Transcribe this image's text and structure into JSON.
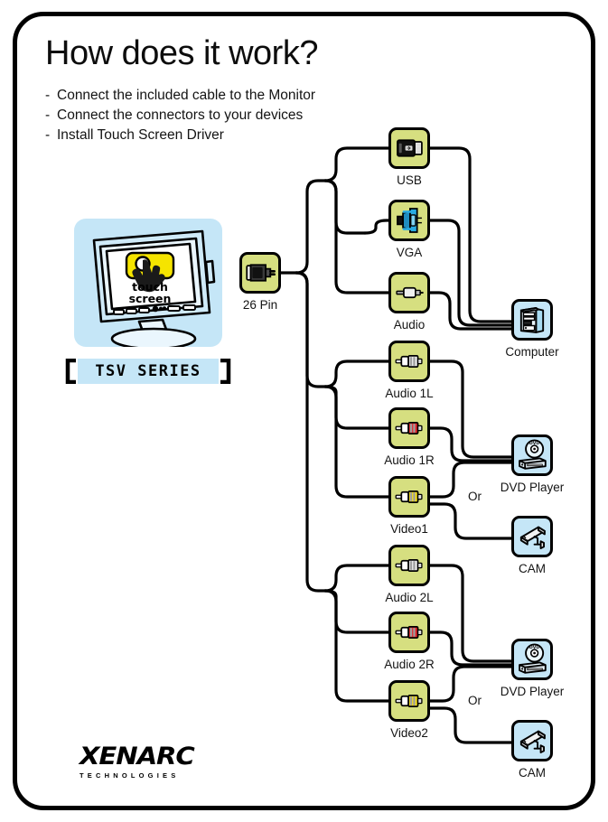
{
  "header": {
    "title": "How does it work?",
    "dash": "-",
    "steps": [
      "Connect the included cable to the Monitor",
      "Connect the connectors to your devices",
      "Install Touch Screen Driver"
    ]
  },
  "monitor": {
    "screen_line1": "touch",
    "screen_line2": "screen",
    "series_label": "TSV  SERIES",
    "bracket_left": "[",
    "bracket_right": "]"
  },
  "source": {
    "label": "26 Pin",
    "icon": "dsub-26pin-connector-icon"
  },
  "connectors": [
    {
      "id": "usb",
      "label": "USB",
      "icon": "usb-connector-icon",
      "color": "#1a1a1a"
    },
    {
      "id": "vga",
      "label": "VGA",
      "icon": "vga-connector-icon",
      "color": "#29abe2"
    },
    {
      "id": "audio",
      "label": "Audio",
      "icon": "audio-jack-icon",
      "color": "#d9d9d9"
    },
    {
      "id": "audio1l",
      "label": "Audio 1L",
      "icon": "rca-white-connector-icon",
      "color": "#ffffff"
    },
    {
      "id": "audio1r",
      "label": "Audio 1R",
      "icon": "rca-red-connector-icon",
      "color": "#e8252a"
    },
    {
      "id": "video1",
      "label": "Video1",
      "icon": "rca-yellow-connector-icon",
      "color": "#f7e017"
    },
    {
      "id": "audio2l",
      "label": "Audio 2L",
      "icon": "rca-white-connector-icon",
      "color": "#ffffff"
    },
    {
      "id": "audio2r",
      "label": "Audio 2R",
      "icon": "rca-red-connector-icon",
      "color": "#e8252a"
    },
    {
      "id": "video2",
      "label": "Video2",
      "icon": "rca-yellow-connector-icon",
      "color": "#f7e017"
    }
  ],
  "devices": [
    {
      "id": "computer",
      "label": "Computer",
      "icon": "computer-tower-icon"
    },
    {
      "id": "dvd1",
      "label": "DVD Player",
      "icon": "dvd-player-icon"
    },
    {
      "id": "cam1",
      "label": "CAM",
      "icon": "security-camera-icon"
    },
    {
      "id": "dvd2",
      "label": "DVD Player",
      "icon": "dvd-player-icon"
    },
    {
      "id": "cam2",
      "label": "CAM",
      "icon": "security-camera-icon"
    }
  ],
  "or_labels": {
    "group1": "Or",
    "group2": "Or"
  },
  "logo": {
    "name": "XENARC",
    "tagline": "TECHNOLOGIES"
  },
  "colors": {
    "connector_box": "#d6df80",
    "device_box": "#c5e6f7",
    "panel_blue": "#c5e6f7",
    "touch_yellow": "#f5e400",
    "border": "#000000"
  }
}
